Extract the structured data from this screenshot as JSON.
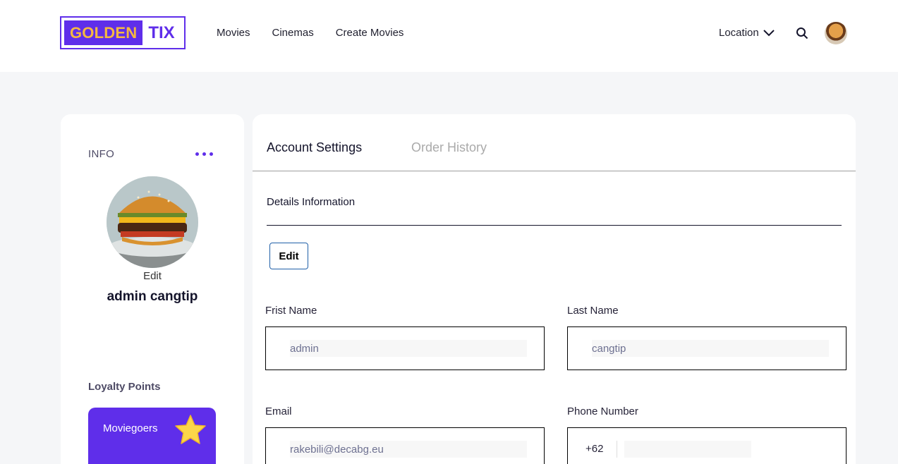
{
  "header": {
    "logo": {
      "part1": "GOLDEN",
      "part2": "TIX"
    },
    "nav": [
      "Movies",
      "Cinemas",
      "Create Movies"
    ],
    "location_label": "Location"
  },
  "profile": {
    "section_label": "INFO",
    "edit_photo_label": "Edit",
    "name": "admin cangtip",
    "loyalty_label": "Loyalty Points",
    "loyalty_tier": "Moviegoers"
  },
  "settings": {
    "tabs": {
      "active": "Account Settings",
      "inactive": "Order History"
    },
    "section_title": "Details Information",
    "edit_button": "Edit",
    "fields": {
      "first_name": {
        "label": "Frist Name",
        "value": "admin"
      },
      "last_name": {
        "label": "Last Name",
        "value": "cangtip"
      },
      "email": {
        "label": "Email",
        "value": "rakebili@decabg.eu"
      },
      "phone": {
        "label": "Phone Number",
        "prefix": "+62",
        "value": ""
      }
    }
  },
  "colors": {
    "brand": "#5f2eea",
    "logo_accent": "#f5b841",
    "background": "#f5f6f8"
  },
  "icons": [
    "chevron-down-icon",
    "search-icon",
    "more-dots-icon",
    "star-icon"
  ]
}
